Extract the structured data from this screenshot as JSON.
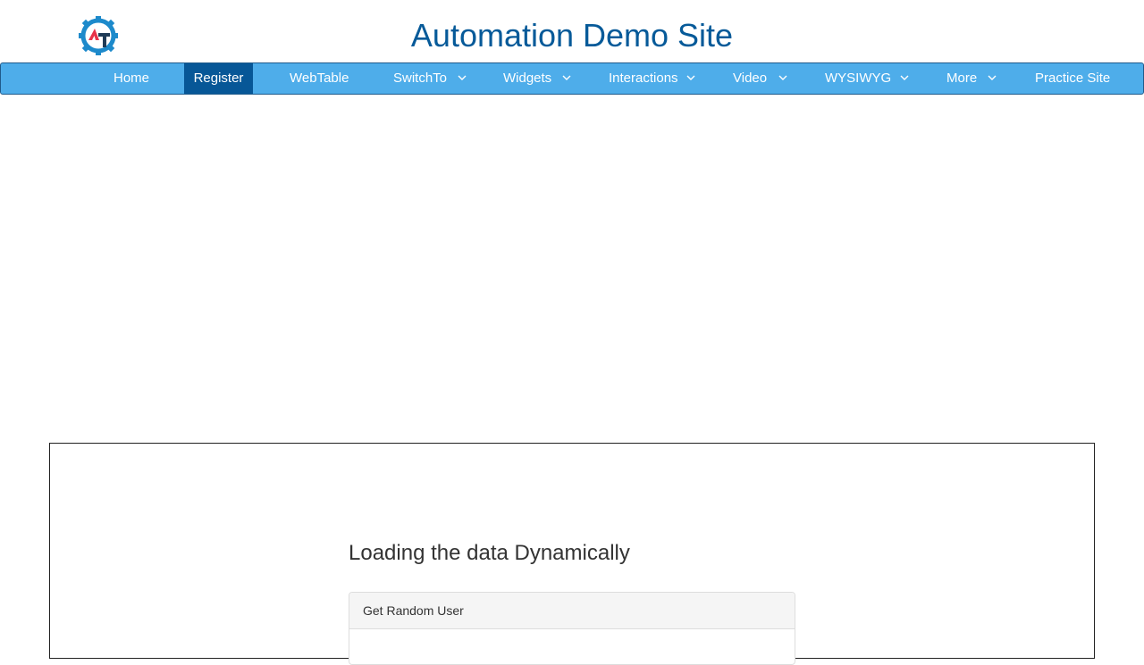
{
  "header": {
    "title": "Automation Demo Site",
    "logo": "automation-testing-logo"
  },
  "nav": {
    "active": "Register",
    "items": [
      {
        "label": "Home"
      },
      {
        "label": "Register"
      },
      {
        "label": "WebTable"
      },
      {
        "label": "SwitchTo"
      },
      {
        "label": "Widgets"
      },
      {
        "label": "Interactions"
      },
      {
        "label": "Video"
      },
      {
        "label": "WYSIWYG"
      },
      {
        "label": "More"
      },
      {
        "label": "Practice Site"
      }
    ],
    "dropdown_icon": "chevron-down-icon"
  },
  "content": {
    "heading": "Loading the data Dynamically",
    "panel_title": "Get Random User"
  },
  "colors": {
    "title": "#065a99",
    "nav_background": "#4eadea",
    "nav_active": "#075797",
    "logo_blue": "#1d8acb",
    "logo_red": "#e8334a",
    "logo_dark": "#1f3b57"
  }
}
